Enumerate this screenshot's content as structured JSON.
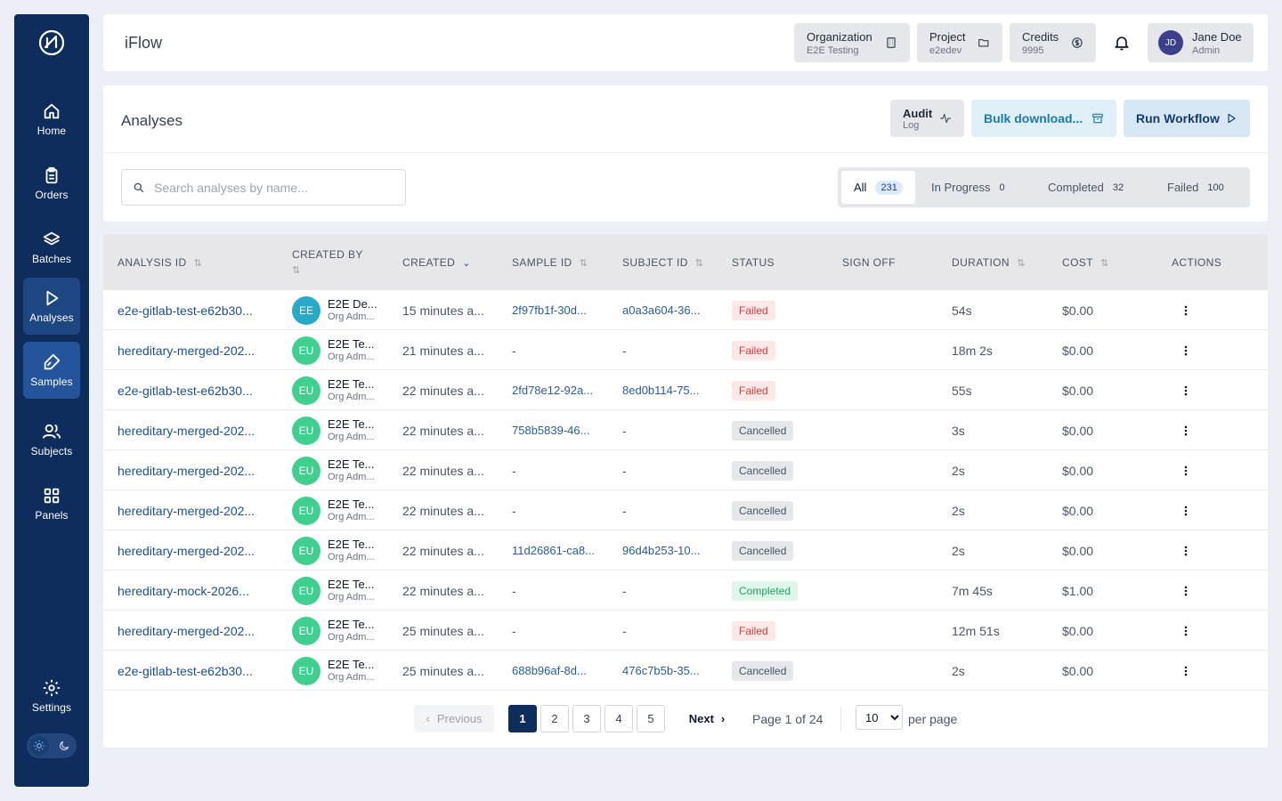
{
  "nav": {
    "items": [
      {
        "label": "Home",
        "icon": "home-icon"
      },
      {
        "label": "Orders",
        "icon": "clipboard-icon"
      },
      {
        "label": "Batches",
        "icon": "layers-icon"
      },
      {
        "label": "Analyses",
        "icon": "play-icon"
      },
      {
        "label": "Samples",
        "icon": "flask-icon"
      },
      {
        "label": "Subjects",
        "icon": "users-icon"
      },
      {
        "label": "Panels",
        "icon": "grid-icon"
      }
    ],
    "settings_label": "Settings",
    "active": "Analyses",
    "selected": "Samples"
  },
  "topbar": {
    "app_title": "iFlow",
    "organization": {
      "label": "Organization",
      "value": "E2E Testing"
    },
    "project": {
      "label": "Project",
      "value": "e2edev"
    },
    "credits": {
      "label": "Credits",
      "value": "9995"
    },
    "user": {
      "initials": "JD",
      "name": "Jane Doe",
      "role": "Admin"
    }
  },
  "header": {
    "title": "Analyses",
    "audit": {
      "line1": "Audit",
      "line2": "Log"
    },
    "bulk_download": "Bulk download...",
    "run_workflow": "Run Workflow",
    "search_placeholder": "Search analyses by name...",
    "tabs": [
      {
        "label": "All",
        "count": "231"
      },
      {
        "label": "In Progress",
        "count": "0"
      },
      {
        "label": "Completed",
        "count": "32"
      },
      {
        "label": "Failed",
        "count": "100"
      }
    ]
  },
  "table": {
    "columns": [
      "ANALYSIS ID",
      "CREATED BY",
      "CREATED",
      "SAMPLE ID",
      "SUBJECT ID",
      "STATUS",
      "SIGN OFF",
      "DURATION",
      "COST",
      "ACTIONS"
    ],
    "rows": [
      {
        "id": "e2e-gitlab-test-e62b30...",
        "initials": "EE",
        "avatar_color": "#27a9c9",
        "name": "E2E De...",
        "role": "Org Adm...",
        "created": "15 minutes a...",
        "sample": "2f97fb1f-30d...",
        "subject": "a0a3a604-36...",
        "status": "Failed",
        "duration": "54s",
        "cost": "$0.00"
      },
      {
        "id": "hereditary-merged-202...",
        "initials": "EU",
        "avatar_color": "#3fcf8e",
        "name": "E2E Te...",
        "role": "Org Adm...",
        "created": "21 minutes a...",
        "sample": "-",
        "subject": "-",
        "status": "Failed",
        "duration": "18m 2s",
        "cost": "$0.00"
      },
      {
        "id": "e2e-gitlab-test-e62b30...",
        "initials": "EU",
        "avatar_color": "#3fcf8e",
        "name": "E2E Te...",
        "role": "Org Adm...",
        "created": "22 minutes a...",
        "sample": "2fd78e12-92a...",
        "subject": "8ed0b114-75...",
        "status": "Failed",
        "duration": "55s",
        "cost": "$0.00"
      },
      {
        "id": "hereditary-merged-202...",
        "initials": "EU",
        "avatar_color": "#3fcf8e",
        "name": "E2E Te...",
        "role": "Org Adm...",
        "created": "22 minutes a...",
        "sample": "758b5839-46...",
        "subject": "-",
        "status": "Cancelled",
        "duration": "3s",
        "cost": "$0.00"
      },
      {
        "id": "hereditary-merged-202...",
        "initials": "EU",
        "avatar_color": "#3fcf8e",
        "name": "E2E Te...",
        "role": "Org Adm...",
        "created": "22 minutes a...",
        "sample": "-",
        "subject": "-",
        "status": "Cancelled",
        "duration": "2s",
        "cost": "$0.00"
      },
      {
        "id": "hereditary-merged-202...",
        "initials": "EU",
        "avatar_color": "#3fcf8e",
        "name": "E2E Te...",
        "role": "Org Adm...",
        "created": "22 minutes a...",
        "sample": "-",
        "subject": "-",
        "status": "Cancelled",
        "duration": "2s",
        "cost": "$0.00"
      },
      {
        "id": "hereditary-merged-202...",
        "initials": "EU",
        "avatar_color": "#3fcf8e",
        "name": "E2E Te...",
        "role": "Org Adm...",
        "created": "22 minutes a...",
        "sample": "11d26861-ca8...",
        "subject": "96d4b253-10...",
        "status": "Cancelled",
        "duration": "2s",
        "cost": "$0.00"
      },
      {
        "id": "hereditary-mock-2026...",
        "initials": "EU",
        "avatar_color": "#3fcf8e",
        "name": "E2E Te...",
        "role": "Org Adm...",
        "created": "22 minutes a...",
        "sample": "-",
        "subject": "-",
        "status": "Completed",
        "duration": "7m 45s",
        "cost": "$1.00"
      },
      {
        "id": "hereditary-merged-202...",
        "initials": "EU",
        "avatar_color": "#3fcf8e",
        "name": "E2E Te...",
        "role": "Org Adm...",
        "created": "25 minutes a...",
        "sample": "-",
        "subject": "-",
        "status": "Failed",
        "duration": "12m 51s",
        "cost": "$0.00"
      },
      {
        "id": "e2e-gitlab-test-e62b30...",
        "initials": "EU",
        "avatar_color": "#3fcf8e",
        "name": "E2E Te...",
        "role": "Org Adm...",
        "created": "25 minutes a...",
        "sample": "688b96af-8d...",
        "subject": "476c7b5b-35...",
        "status": "Cancelled",
        "duration": "2s",
        "cost": "$0.00"
      }
    ]
  },
  "pagination": {
    "previous": "Previous",
    "next": "Next",
    "pages": [
      "1",
      "2",
      "3",
      "4",
      "5"
    ],
    "current": "1",
    "info": "Page 1 of 24",
    "per_page_value": "10",
    "per_page_label": "per page"
  },
  "colors": {
    "sidebar": "#0e2d5c",
    "accent": "#1f4e8c",
    "failed": "#d63b3b",
    "completed": "#1ea563"
  }
}
